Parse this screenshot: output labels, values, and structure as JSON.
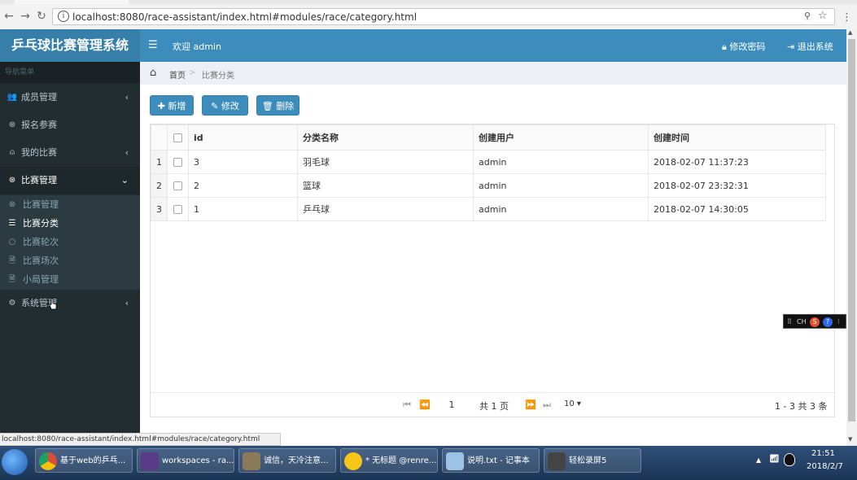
{
  "browser": {
    "url": "localhost:8080/race-assistant/index.html#modules/race/category.html",
    "back_icon": "←",
    "forward_icon": "→",
    "reload_icon": "↻"
  },
  "app": {
    "logo": "乒乓球比赛管理系统",
    "welcome": "欢迎 admin",
    "change_password": "修改密码",
    "logout": "退出系统"
  },
  "sidebar": {
    "header": "导航菜单",
    "items": [
      {
        "label": "成员管理",
        "icon": "users-icon",
        "glyph": "👥",
        "arrow": "‹"
      },
      {
        "label": "报名参赛",
        "icon": "basketball-icon",
        "glyph": "⊛",
        "arrow": ""
      },
      {
        "label": "我的比赛",
        "icon": "user-icon",
        "glyph": "⍝",
        "arrow": "‹"
      },
      {
        "label": "比赛管理",
        "icon": "basketball-icon",
        "glyph": "⊛",
        "arrow": "⌄"
      },
      {
        "label": "系统管理",
        "icon": "gear-icon",
        "glyph": "⚙",
        "arrow": "‹"
      }
    ],
    "subitems": [
      {
        "label": "比赛管理",
        "icon": "basketball-icon",
        "glyph": "⊛"
      },
      {
        "label": "比赛分类",
        "icon": "list-icon",
        "glyph": "☰"
      },
      {
        "label": "比赛轮次",
        "icon": "circle-icon",
        "glyph": "○"
      },
      {
        "label": "比赛场次",
        "icon": "file-icon",
        "glyph": "🗎"
      },
      {
        "label": "小局管理",
        "icon": "file-icon",
        "glyph": "🗎"
      }
    ]
  },
  "breadcrumb": {
    "home": "首页",
    "separator": ">",
    "current": "比赛分类"
  },
  "toolbar": {
    "add": "✚ 新增",
    "edit": "✎ 修改",
    "delete": "🗑 删除"
  },
  "table": {
    "columns": [
      "id",
      "分类名称",
      "创建用户",
      "创建时间"
    ],
    "rows": [
      {
        "rownum": "1",
        "id": "3",
        "name": "羽毛球",
        "user": "admin",
        "time": "2018-02-07 11:37:23"
      },
      {
        "rownum": "2",
        "id": "2",
        "name": "篮球",
        "user": "admin",
        "time": "2018-02-07 23:32:31"
      },
      {
        "rownum": "3",
        "id": "1",
        "name": "乒乓球",
        "user": "admin",
        "time": "2018-02-07 14:30:05"
      }
    ]
  },
  "pager": {
    "first": "⏮",
    "prev": "⏪",
    "page": "1",
    "total": "共 1 页",
    "next": "⏩",
    "last": "⏭",
    "page_size": "10 ▾",
    "range": "1 - 3   共 3 条"
  },
  "status_bar": "localhost:8080/race-assistant/index.html#modules/race/category.html",
  "ime": "CH",
  "taskbar": {
    "tasks": [
      {
        "label": "基于web的乒乓...",
        "color": "#dd4b39"
      },
      {
        "label": "workspaces - ra...",
        "color": "#5b3a8a"
      },
      {
        "label": "诚信，天冷注意...",
        "color": "#8a7a5a"
      },
      {
        "label": "* 无标题 @renre...",
        "color": "#f5c518"
      },
      {
        "label": "说明.txt - 记事本",
        "color": "#9cc3e6"
      },
      {
        "label": "轻松录屏5",
        "color": "#444444"
      }
    ],
    "time": "21:51",
    "date": "2018/2/7"
  },
  "colors": {
    "header": "#3c8dbc",
    "logo_bg": "#367fa9",
    "sidebar": "#222d32",
    "button": "#3c8dbc"
  }
}
